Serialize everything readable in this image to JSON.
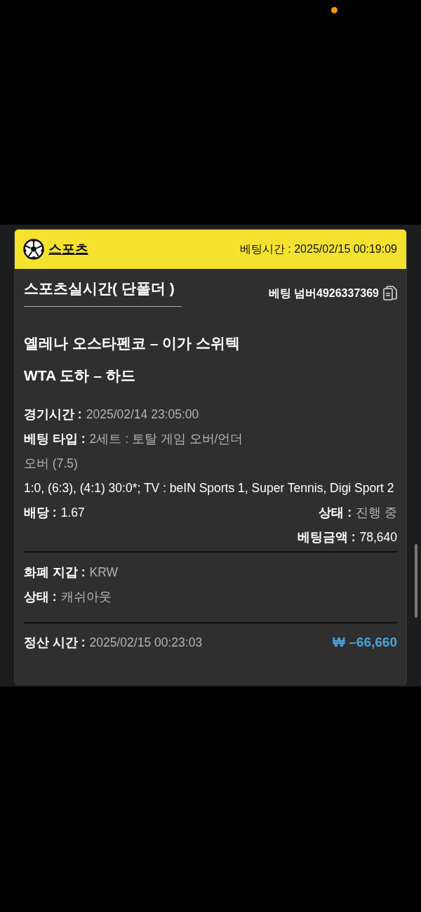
{
  "header": {
    "category": "스포츠",
    "bet_time": "베팅시간 : 2025/02/15 00:19:09"
  },
  "title": "스포츠실시간( 단폴더 )",
  "bet_number": "베팅 넘버4926337369",
  "match": "옐레나 오스타펜코 – 이가 스위텍",
  "league": "WTA 도하 – 하드",
  "details": [
    {
      "kind": "pair",
      "label": "경기시간 :",
      "value": "2025/02/14 23:05:00"
    },
    {
      "kind": "pair",
      "label": "베팅 타입 :",
      "value": "2세트 : 토탈 게임 오버/언더"
    },
    {
      "kind": "muted",
      "value": "오버 (7.5)"
    },
    {
      "kind": "plain",
      "value": "1:0, (6:3), (4:1) 30:0*; TV : beIN Sports 1, Super Tennis, Digi Sport 2"
    }
  ],
  "odds": {
    "label": "배당 :",
    "value": "1.67"
  },
  "status": {
    "label": "상태 :",
    "value": "진행 중"
  },
  "stake": {
    "label": "베팅금액 :",
    "value": "78,640"
  },
  "wallet": [
    {
      "label": "화폐 지갑 :",
      "value": "KRW"
    },
    {
      "label": "상태 :",
      "value": "캐쉬아웃"
    }
  ],
  "settlement": {
    "label": "정산 시간 :",
    "value": "2025/02/15 00:23:03",
    "amount": "₩ –66,660"
  }
}
